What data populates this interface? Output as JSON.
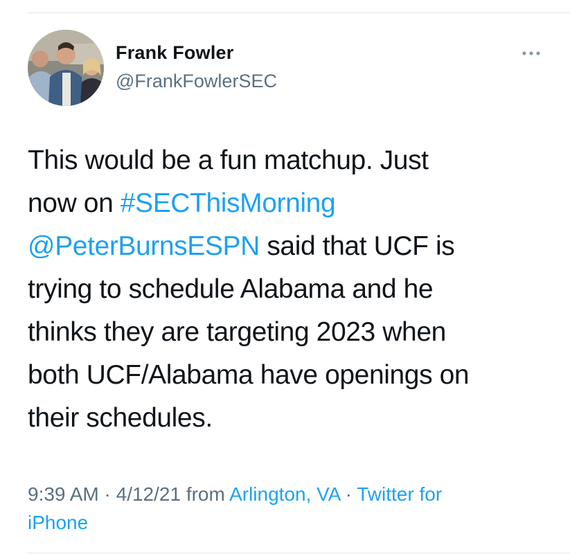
{
  "author": {
    "display_name": "Frank Fowler",
    "handle": "@FrankFowlerSEC",
    "avatar": "profile-photo"
  },
  "menu": {
    "icon": "more-horizontal-icon"
  },
  "tweet": {
    "line1": "This would be a fun matchup. Just",
    "line2_prefix": "now on ",
    "hashtag": "#SECThisMorning",
    "mention": "@PeterBurnsESPN",
    "line3_suffix": " said that UCF is",
    "line4": "trying to schedule Alabama and he",
    "line5": "thinks they are targeting 2023 when",
    "line6": "both UCF/Alabama have openings on",
    "line7": "their schedules."
  },
  "meta": {
    "time": "9:39 AM",
    "sep1": " · ",
    "date": "4/12/21",
    "from": " from ",
    "location": "Arlington, VA",
    "sep2": " · ",
    "source_part1": "Twitter for",
    "source_part2": "iPhone"
  },
  "colors": {
    "link": "#1da1f2",
    "secondary_text": "#5b7083",
    "primary_text": "#0f1419"
  }
}
